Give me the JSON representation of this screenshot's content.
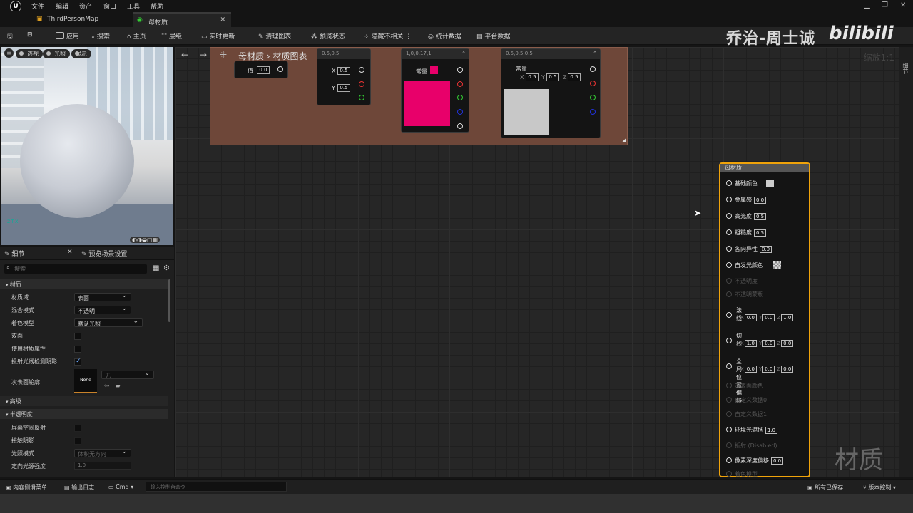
{
  "menu": {
    "items": [
      "文件",
      "编辑",
      "资产",
      "窗口",
      "工具",
      "帮助"
    ]
  },
  "tabs": [
    {
      "label": "ThirdPersonMap"
    },
    {
      "label": "母材质"
    }
  ],
  "toolbar": {
    "save": "",
    "apply": "应用",
    "search": "搜索",
    "home": "主页",
    "hierarchy": "层级",
    "live_update": "实时更新",
    "clean_graph": "清理图表",
    "preview_state": "预览状态",
    "hide_unrelated": "隐藏不相关",
    "stats": "统计数据",
    "platform_stats": "平台数据"
  },
  "watermark": {
    "author": "乔治-周士诚",
    "site": "bilibili",
    "bottom_right": "材质"
  },
  "viewport": {
    "perspective": "透视",
    "lit": "光照",
    "show": "显示"
  },
  "details": {
    "tab_details": "细节",
    "tab_preview": "预览场景设置",
    "search_placeholder": "搜索",
    "section_material": "材质",
    "props": {
      "domain_label": "材质域",
      "domain_value": "表面",
      "blend_label": "混合模式",
      "blend_value": "不透明",
      "shading_label": "着色模型",
      "shading_value": "默认光照",
      "two_sided": "双面",
      "use_material_attributes": "使用材质属性",
      "cast_ray_traced_shadows": "投射光线检测阴影",
      "subsurface_profile": "次表面轮廓",
      "subsurface_thumb": "None",
      "subsurface_value": "无"
    },
    "section_advanced": "高级",
    "section_translucency": "半透明度",
    "trans": {
      "ssr": "屏幕空间反射",
      "contact_shadows": "接触阴影",
      "lighting_mode": "光照模式",
      "lighting_mode_value": "体积无方向",
      "directional_intensity": "定向光源强度",
      "directional_intensity_value": "1.0"
    }
  },
  "graph": {
    "breadcrumb_root": "母材质",
    "breadcrumb_child": "材质图表",
    "zoom": "缩放1:1",
    "const_node": {
      "label": "值",
      "value": "0.0"
    },
    "vec2_node": {
      "header": "0.5,0.5",
      "x": "0.5",
      "y": "0.5"
    },
    "color_node": {
      "header": "1,0,0.17,1",
      "label": "常量",
      "color": "#e8006a"
    },
    "vec3_node": {
      "header": "0.5,0.5,0.5",
      "label": "常量",
      "x": "0.5",
      "y": "0.5",
      "z": "0.5",
      "color": "#c8c8c8"
    },
    "material_node": {
      "title": "母材质",
      "base_color": "基础颜色",
      "metallic": "金属感",
      "metallic_v": "0.0",
      "specular": "高光度",
      "specular_v": "0.5",
      "roughness": "粗糙度",
      "roughness_v": "0.5",
      "anisotropy": "各向异性",
      "anisotropy_v": "0.0",
      "emissive": "自发光颜色",
      "opacity": "不透明度",
      "opacity_mask": "不透明蒙版",
      "normal": "法线",
      "normal_x": "0.0",
      "normal_y": "0.0",
      "normal_z": "1.0",
      "tangent": "切线",
      "tangent_x": "1.0",
      "tangent_y": "0.0",
      "tangent_z": "0.0",
      "wpo": "全局位置偏移",
      "wpo_x": "0.0",
      "wpo_y": "0.0",
      "wpo_z": "0.0",
      "subsurface": "次表面颜色",
      "custom0": "自定义数据0",
      "custom1": "自定义数据1",
      "ao": "环境光遮挡",
      "ao_v": "1.0",
      "refraction": "折射 (Disabled)",
      "pdo": "像素深度偏移",
      "pdo_v": "0.0",
      "shading": "着色模型"
    },
    "right_strip": "细节"
  },
  "status": {
    "content_drawer": "内容侧滑菜单",
    "output_log": "输出日志",
    "cmd": "Cmd",
    "console_placeholder": "输入控制台命令",
    "saved": "所有已保存",
    "source_control": "版本控制"
  }
}
